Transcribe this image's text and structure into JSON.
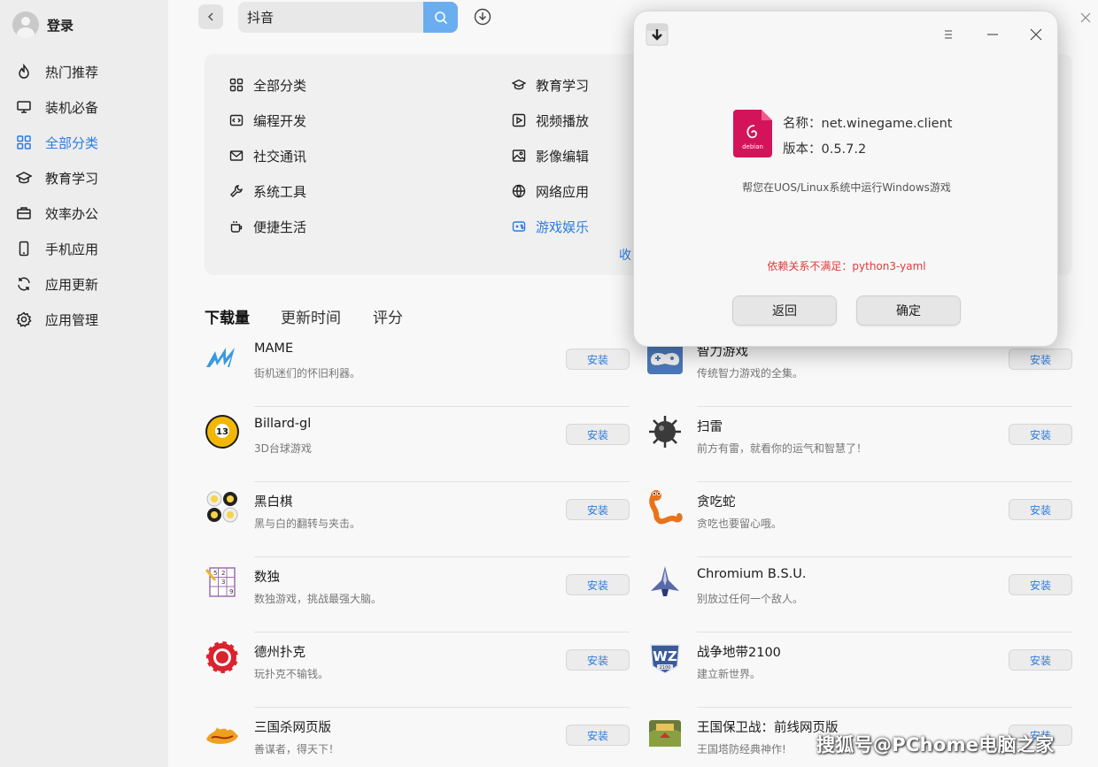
{
  "sidebar": {
    "login_label": "登录",
    "items": [
      {
        "label": "热门推荐",
        "icon": "flame-icon"
      },
      {
        "label": "装机必备",
        "icon": "monitor-icon"
      },
      {
        "label": "全部分类",
        "icon": "grid-icon",
        "active": true
      },
      {
        "label": "教育学习",
        "icon": "graduation-cap-icon"
      },
      {
        "label": "效率办公",
        "icon": "briefcase-icon"
      },
      {
        "label": "手机应用",
        "icon": "phone-icon"
      },
      {
        "label": "应用更新",
        "icon": "refresh-icon"
      },
      {
        "label": "应用管理",
        "icon": "gear-icon"
      }
    ]
  },
  "search": {
    "value": "抖音"
  },
  "categories": {
    "left": [
      {
        "label": "全部分类",
        "icon": "grid-icon"
      },
      {
        "label": "编程开发",
        "icon": "code-icon"
      },
      {
        "label": "社交通讯",
        "icon": "mail-icon"
      },
      {
        "label": "系统工具",
        "icon": "wrench-icon"
      },
      {
        "label": "便捷生活",
        "icon": "cup-icon"
      }
    ],
    "right": [
      {
        "label": "教育学习",
        "icon": "graduation-cap-icon"
      },
      {
        "label": "视频播放",
        "icon": "play-icon"
      },
      {
        "label": "影像编辑",
        "icon": "image-icon"
      },
      {
        "label": "网络应用",
        "icon": "globe-icon"
      },
      {
        "label": "游戏娱乐",
        "icon": "gamepad-icon",
        "active": true
      }
    ],
    "collapse_label": "收"
  },
  "sort_tabs": [
    "下载量",
    "更新时间",
    "评分"
  ],
  "install_label": "安装",
  "apps_left": [
    {
      "name": "MAME",
      "desc": "街机迷们的怀旧利器。",
      "icon": "mame-icon"
    },
    {
      "name": "Billard-gl",
      "desc": "3D台球游戏",
      "icon": "billiard-ball-icon"
    },
    {
      "name": "黑白棋",
      "desc": "黑与白的翻转与夹击。",
      "icon": "reversi-icon"
    },
    {
      "name": "数独",
      "desc": "数独游戏，挑战最强大脑。",
      "icon": "sudoku-icon"
    },
    {
      "name": "德州扑克",
      "desc": "玩扑克不输钱。",
      "icon": "poker-chip-icon"
    },
    {
      "name": "三国杀网页版",
      "desc": "善谋者，得天下！",
      "icon": "sanguosha-icon"
    }
  ],
  "apps_right": [
    {
      "name": "智力游戏",
      "desc": "传统智力游戏的全集。",
      "icon": "gamepad-app-icon"
    },
    {
      "name": "扫雷",
      "desc": "前方有雷，就看你的运气和智慧了！",
      "icon": "mine-icon"
    },
    {
      "name": "贪吃蛇",
      "desc": "贪吃也要留心哦。",
      "icon": "snake-icon"
    },
    {
      "name": "Chromium B.S.U.",
      "desc": "别放过任何一个敌人。",
      "icon": "spaceship-icon"
    },
    {
      "name": "战争地带2100",
      "desc": "建立新世界。",
      "icon": "warzone-icon"
    },
    {
      "name": "王国保卫战：前线网页版",
      "desc": "王国塔防经典神作!",
      "icon": "kingdom-rush-icon"
    }
  ],
  "dialog": {
    "name_label": "名称：",
    "name_value": "net.winegame.client",
    "version_label": "版本：",
    "version_value": "0.5.7.2",
    "deb_icon_text": "debian",
    "description": "帮您在UOS/Linux系统中运行Windows游戏",
    "error_label": "依赖关系不满足：",
    "error_value": "python3-yaml",
    "back_label": "返回",
    "ok_label": "确定"
  },
  "watermark": "搜狐号@PChome电脑之家",
  "colors": {
    "accent": "#2c7be0",
    "error": "#e03a3a",
    "search_button": "#6aaef0",
    "deb_pink": "#d4145a"
  }
}
